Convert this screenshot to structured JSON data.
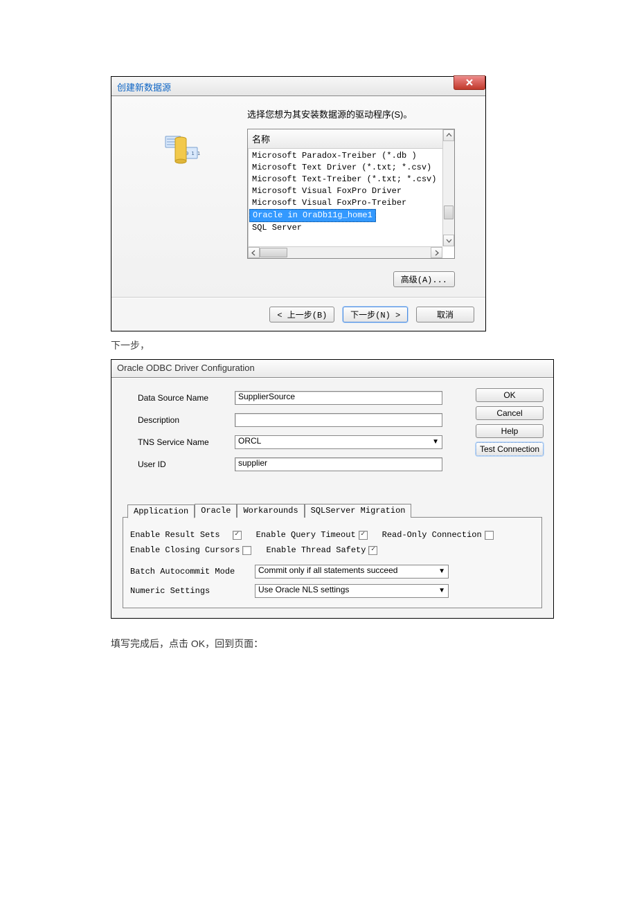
{
  "dialog1": {
    "title": "创建新数据源",
    "instruction": "选择您想为其安装数据源的驱动程序(S)。",
    "listHeader": "名称",
    "drivers": [
      "Microsoft Paradox-Treiber (*.db )",
      "Microsoft Text Driver (*.txt; *.csv)",
      "Microsoft Text-Treiber (*.txt; *.csv)",
      "Microsoft Visual FoxPro Driver",
      "Microsoft Visual FoxPro-Treiber",
      "Oracle in OraDb11g_home1",
      "SQL Server"
    ],
    "selectedIndex": 5,
    "advanced": "高级(A)...",
    "back": "< 上一步(B)",
    "next": "下一步(N) >",
    "cancel": "取消"
  },
  "caption1": "下一步，",
  "dialog2": {
    "title": "Oracle ODBC Driver Configuration",
    "fields": {
      "dsnLabel": "Data Source Name",
      "dsnValue": "SupplierSource",
      "descLabel": "Description",
      "descValue": "",
      "tnsLabel": "TNS Service Name",
      "tnsValue": "ORCL",
      "userLabel": "User ID",
      "userValue": "supplier"
    },
    "buttons": {
      "ok": "OK",
      "cancel": "Cancel",
      "help": "Help",
      "test": "Test Connection"
    },
    "tabs": [
      "Application",
      "Oracle",
      "Workarounds",
      "SQLServer Migration"
    ],
    "activeTab": 0,
    "checks": {
      "enableResultSets": {
        "label": "Enable Result Sets",
        "checked": true
      },
      "enableQueryTimeout": {
        "label": "Enable Query Timeout",
        "checked": true
      },
      "readOnly": {
        "label": "Read-Only Connection",
        "checked": false
      },
      "enableClosingCursors": {
        "label": "Enable Closing Cursors",
        "checked": false
      },
      "enableThreadSafety": {
        "label": "Enable Thread Safety",
        "checked": true
      }
    },
    "selects": {
      "batchLabel": "Batch Autocommit Mode",
      "batchValue": "Commit only if all statements succeed",
      "numLabel": "Numeric Settings",
      "numValue": "Use Oracle NLS settings"
    }
  },
  "caption2": "填写完成后，点击 OK，回到页面："
}
